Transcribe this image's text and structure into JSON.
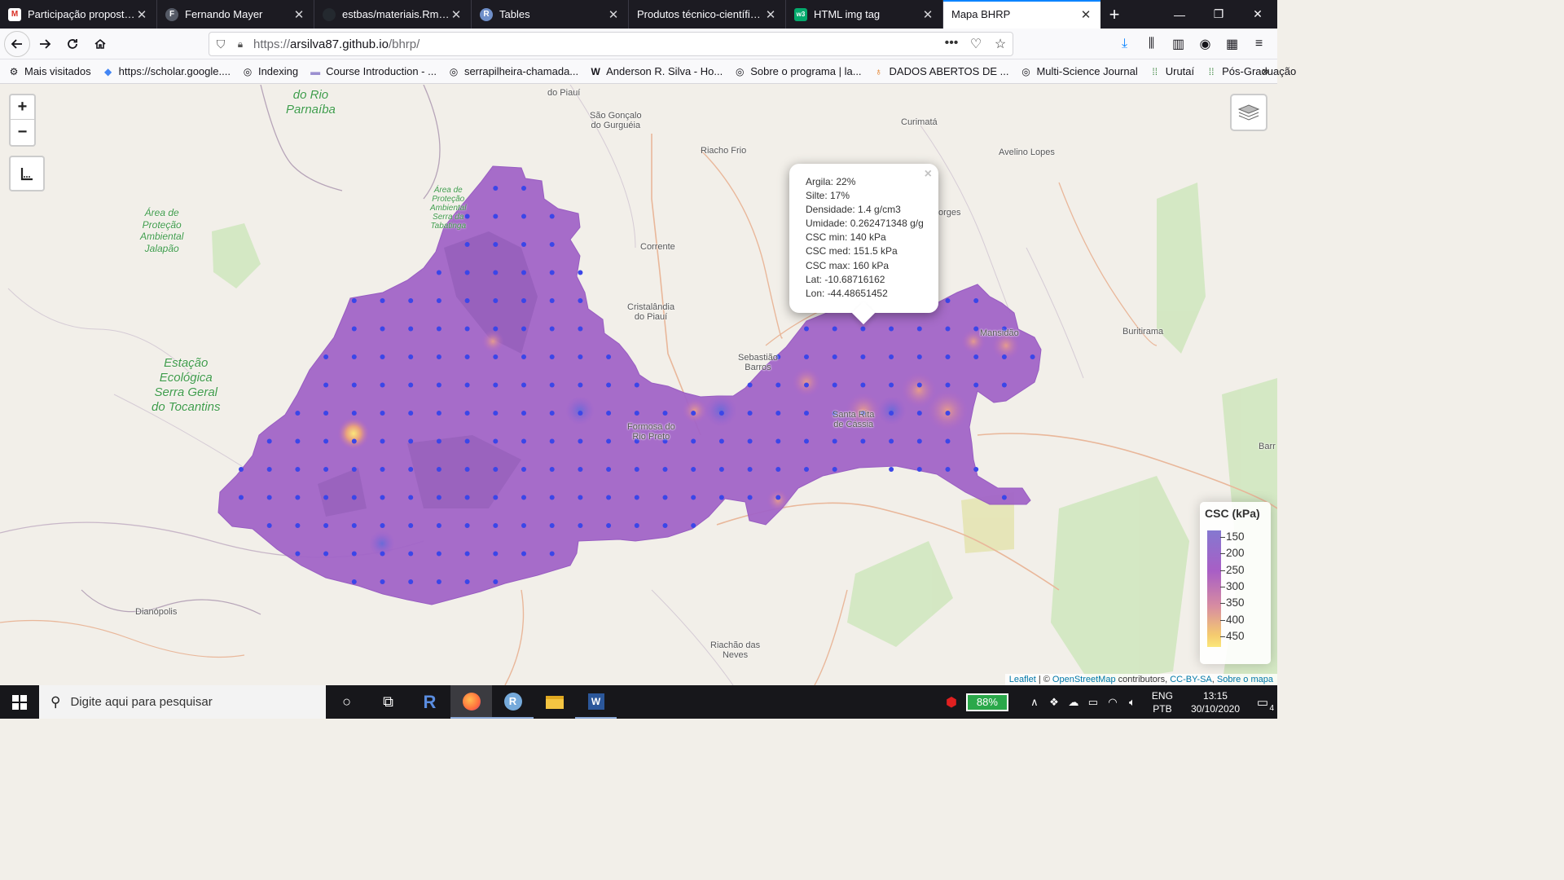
{
  "tabs": [
    {
      "title": "Participação proposta -",
      "favicon_color": "#d93025",
      "favicon": "M"
    },
    {
      "title": "Fernando Mayer",
      "favicon_color": "#555a66",
      "favicon": "F"
    },
    {
      "title": "estbas/materiais.Rmd at",
      "favicon_color": "#24292f",
      "favicon": ""
    },
    {
      "title": "Tables",
      "favicon_color": "#6f8fc9",
      "favicon": "R"
    },
    {
      "title": "Produtos técnico-científicos",
      "favicon_color": "transparent",
      "favicon": ""
    },
    {
      "title": "HTML img tag",
      "favicon_color": "#04aa6d",
      "favicon": "w3"
    },
    {
      "title": "Mapa BHRP",
      "favicon_color": "transparent",
      "favicon": "",
      "active": true
    }
  ],
  "nav": {
    "url_prefix": "https://",
    "url_host": "arsilva87.github.io",
    "url_path": "/bhrp/"
  },
  "bookmarks": [
    {
      "label": "Mais visitados",
      "icon": "gear-icon"
    },
    {
      "label": "https://scholar.google....",
      "icon": "scholar-icon"
    },
    {
      "label": "Indexing",
      "icon": "globe-icon"
    },
    {
      "label": "Course Introduction - ...",
      "icon": "doc-icon"
    },
    {
      "label": "serrapilheira-chamada...",
      "icon": "globe-icon"
    },
    {
      "label": "Anderson R. Silva - Ho...",
      "icon": "w-icon"
    },
    {
      "label": "Sobre o programa | la...",
      "icon": "globe-icon"
    },
    {
      "label": "DADOS ABERTOS DE ...",
      "icon": "pin-icon"
    },
    {
      "label": "Multi-Science Journal",
      "icon": "globe-icon"
    },
    {
      "label": "Urutaí",
      "icon": "grid-icon"
    },
    {
      "label": "Pós-Graduação",
      "icon": "grid-icon"
    }
  ],
  "map": {
    "places": [
      {
        "name": "do Rio\nParnaíba",
        "kind": "park-big"
      },
      {
        "name": "do Piauí"
      },
      {
        "name": "São Gonçalo\ndo Gurguéia"
      },
      {
        "name": "Curimatá"
      },
      {
        "name": "Riacho Frio"
      },
      {
        "name": "Avelino Lopes"
      },
      {
        "name": "Área de\nProteção\nAmbiental\nSerra da\nTabatinga",
        "kind": "park-small"
      },
      {
        "name": "Área de\nProteção\nAmbiental\nJalapão",
        "kind": "park"
      },
      {
        "name": "Corrente"
      },
      {
        "name": "orges"
      },
      {
        "name": "Cristalândia\ndo Piauí"
      },
      {
        "name": "Mansidão"
      },
      {
        "name": "Buritirama"
      },
      {
        "name": "Sebastião\nBarros"
      },
      {
        "name": "Estação\nEcológica\nSerra Geral\ndo Tocantins",
        "kind": "park-big"
      },
      {
        "name": "Santa Rita\nde Cássia"
      },
      {
        "name": "Formosa do\nRio Preto"
      },
      {
        "name": "Barr"
      },
      {
        "name": "Dianópolis"
      },
      {
        "name": "Riachão das\nNeves"
      }
    ],
    "popup": {
      "lines": [
        "Argila: 22%",
        "Silte: 17%",
        "Densidade: 1.4 g/cm3",
        "Umidade: 0.262471348 g/g",
        "CSC min: 140 kPa",
        "CSC med: 151.5 kPa",
        "CSC max: 160 kPa",
        "Lat: -10.68716162",
        "Lon: -44.48651452"
      ],
      "close": "×"
    },
    "legend": {
      "title": "CSC (kPa)",
      "ticks": [
        "150",
        "200",
        "250",
        "300",
        "350",
        "400",
        "450"
      ],
      "colors": [
        "#8578d0",
        "#a85ec5",
        "#d78ca1",
        "#f5cb6f",
        "#fbe77a"
      ]
    },
    "attribution": {
      "leaflet": "Leaflet",
      "sep": " | © ",
      "osm": "OpenStreetMap",
      "contrib": " contributors, ",
      "license": "CC-BY-SA",
      "comma": ", ",
      "about": "Sobre o mapa"
    },
    "zoom_in": "+",
    "zoom_out": "−"
  },
  "taskbar": {
    "search_placeholder": "Digite aqui para pesquisar",
    "battery": "88%",
    "lang_top": "ENG",
    "lang_bottom": "PTB",
    "time": "13:15",
    "date": "30/10/2020",
    "notifications": "4"
  }
}
